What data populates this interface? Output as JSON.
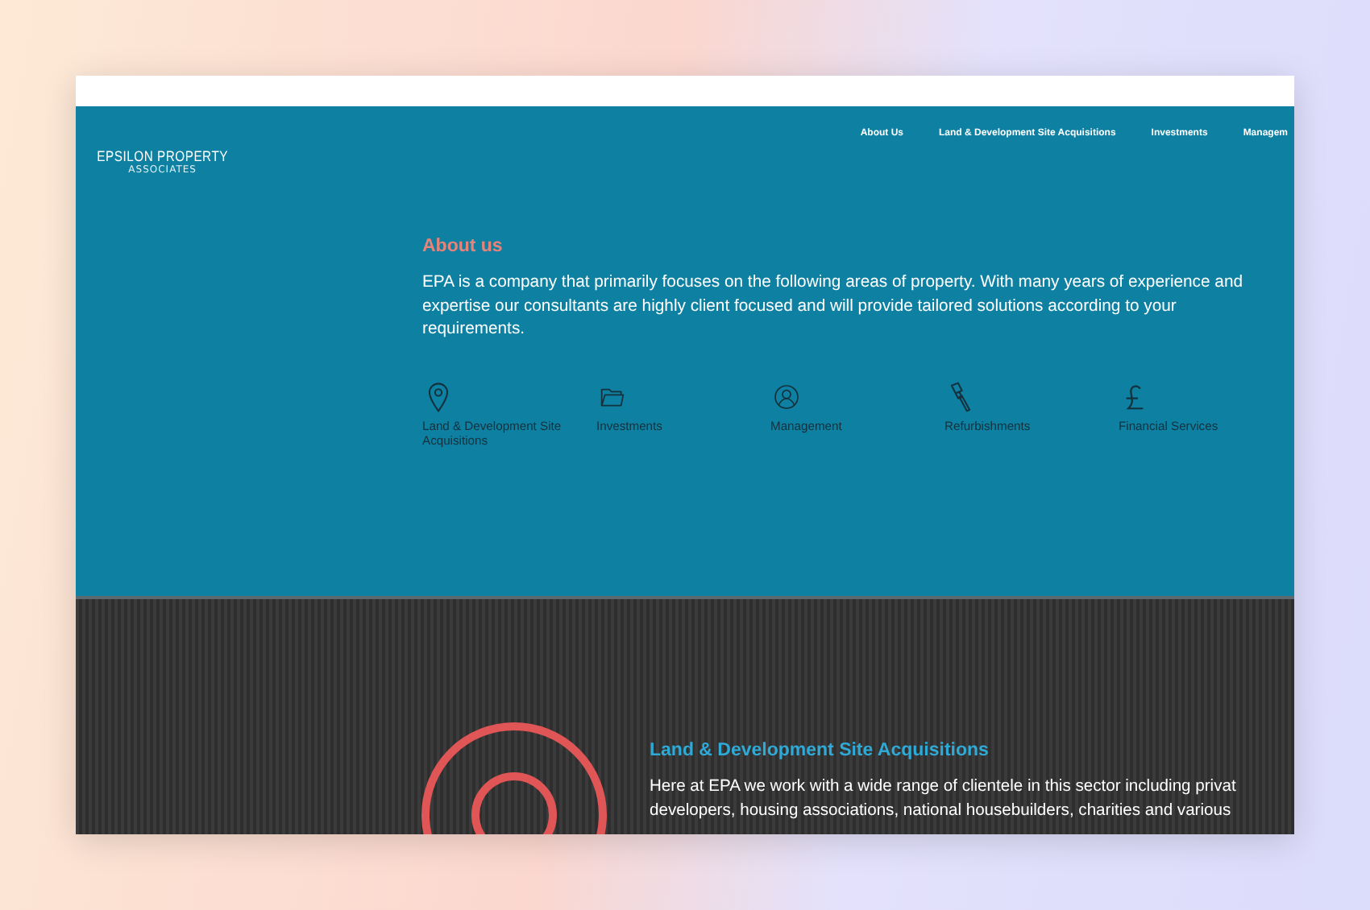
{
  "header": {
    "logo": {
      "name": "EPSILON PROPERTY",
      "tagline": "ASSOCIATES"
    },
    "nav": [
      {
        "label": "About Us"
      },
      {
        "label": "Land & Development Site Acquisitions"
      },
      {
        "label": "Investments"
      },
      {
        "label": "Managem"
      }
    ]
  },
  "about": {
    "title": "About us",
    "text": "EPA is a company that primarily focuses on the following areas of property. With many years of experience and expertise our consultants are highly client focused and will provide tailored solutions according to your requirements.",
    "services": [
      {
        "kind": "pin",
        "label": "Land & Development Site Acquisitions"
      },
      {
        "kind": "folder",
        "label": "Investments"
      },
      {
        "kind": "person",
        "label": "Management"
      },
      {
        "kind": "brush",
        "label": "Refurbishments"
      },
      {
        "kind": "pound",
        "label": "Financial Services"
      }
    ]
  },
  "feature": {
    "title": "Land & Development Site Acquisitions",
    "lines": [
      "Here at EPA we work with a wide range of clientele in this sector including privat",
      "developers, housing associations, national housebuilders, charities and various"
    ]
  }
}
